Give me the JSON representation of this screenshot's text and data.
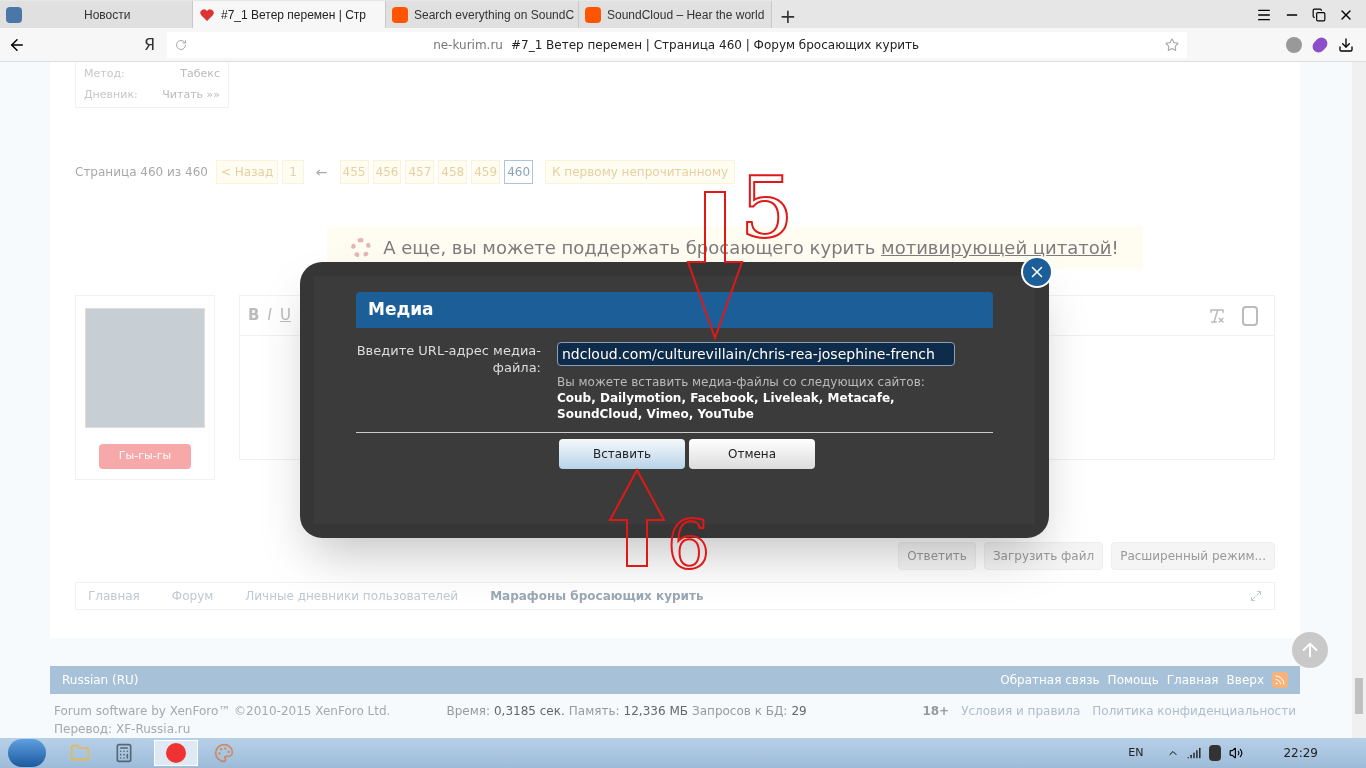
{
  "browser": {
    "tabs": [
      {
        "label": "Новости",
        "selected": false
      },
      {
        "label": "#7_1 Ветер перемен | Стр",
        "selected": true
      },
      {
        "label": "Search everything on SoundC",
        "selected": false
      },
      {
        "label": "SoundCloud – Hear the world",
        "selected": false
      }
    ],
    "new_tab": "+",
    "logo": "Я",
    "domain": "ne-kurim.ru",
    "page_title": "#7_1 Ветер перемен | Страница 460 | Форум бросающих курить"
  },
  "profile": [
    {
      "label": "Метод:",
      "value": "Табекс"
    },
    {
      "label": "Дневник:",
      "value": "Читать »»"
    }
  ],
  "pagination": {
    "summary": "Страница 460 из 460",
    "prev": "< Назад",
    "pages_before": [
      {
        "label": "1",
        "selected": false
      }
    ],
    "ellipsis": "←",
    "pages": [
      {
        "label": "455",
        "selected": false
      },
      {
        "label": "456",
        "selected": false
      },
      {
        "label": "457",
        "selected": false
      },
      {
        "label": "458",
        "selected": false
      },
      {
        "label": "459",
        "selected": false
      },
      {
        "label": "460",
        "selected": true
      }
    ],
    "unread": "К первому непрочитанному"
  },
  "notice": {
    "text": "А еще, вы можете поддержать бросающего курить ",
    "link": "мотивирующей цитатой",
    "end": "!"
  },
  "editor": {
    "badge": "Гы-гы-гы",
    "toolbar": [
      "B",
      "I",
      "U"
    ]
  },
  "form_buttons": [
    "Ответить",
    "Загрузить файл",
    "Расширенный режим..."
  ],
  "dialog": {
    "title": "Медиа",
    "label": "Введите URL-адрес медиа-файла:",
    "value": "ndcloud.com/culturevillain/chris-rea-josephine-french",
    "hint": "Вы можете вставить медиа-файлы со следующих сайтов:",
    "sites": "Coub, Dailymotion, Facebook, Liveleak, Metacafe, SoundCloud, Vimeo, YouTube",
    "buttons": [
      {
        "label": "Вставить",
        "primary": true
      },
      {
        "label": "Отмена",
        "primary": false
      }
    ]
  },
  "annotations": [
    {
      "number": "5"
    },
    {
      "number": "6"
    }
  ],
  "footer_nav": [
    {
      "label": "Главная",
      "bold": false
    },
    {
      "label": "Форум",
      "bold": false
    },
    {
      "label": "Личные дневники пользователей",
      "bold": false
    },
    {
      "label": "Марафоны бросающих курить",
      "bold": true
    }
  ],
  "footer_bar": {
    "language": "Russian (RU)",
    "links": [
      "Обратная связь",
      "Помощь",
      "Главная",
      "Вверх"
    ]
  },
  "footer_info": {
    "copyright": "Forum software by XenForo™ ©2010-2015 XenForo Ltd.",
    "translation": "Перевод: XF-Russia.ru",
    "stats": [
      {
        "label": "Время:",
        "value": "0,3185 сек."
      },
      {
        "label": "Память:",
        "value": "12,336 МБ"
      },
      {
        "label": "Запросов к БД:",
        "value": "29"
      }
    ],
    "age": "18+",
    "links": [
      "Условия и правила",
      "Политика конфиденциальности"
    ]
  },
  "taskbar": {
    "language": "EN",
    "time": "22:29"
  }
}
